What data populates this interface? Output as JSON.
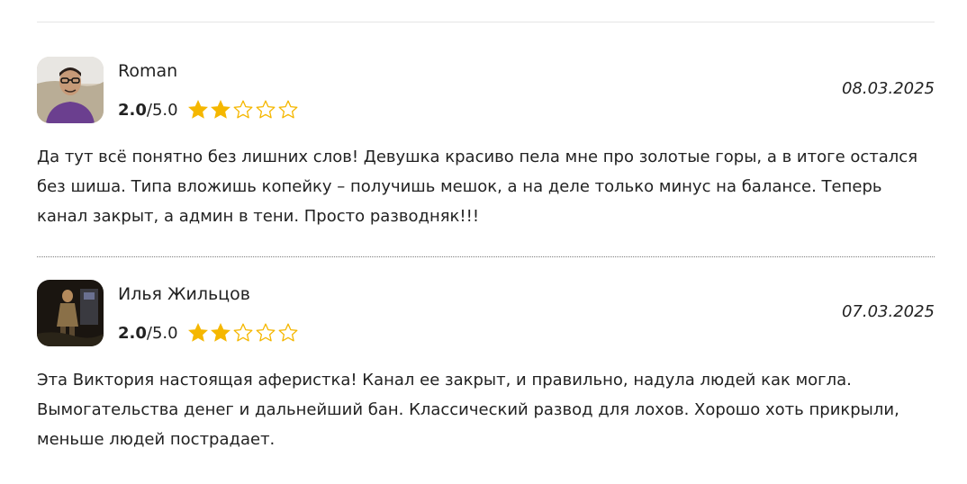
{
  "reviews": [
    {
      "author": "Roman",
      "avatar_icon": "user-photo",
      "rating_value": "2.0",
      "rating_max": "/5.0",
      "stars_filled": 2,
      "stars_total": 5,
      "date": "08.03.2025",
      "text": "Да тут всё понятно без лишних слов! Девушка красиво пела мне про золотые горы, а в итоге остался без шиша. Типа вложишь копейку – получишь мешок, а на деле только минус на балансе. Теперь канал закрыт, а админ в тени. Просто разводняк!!!"
    },
    {
      "author": "Илья Жильцов",
      "avatar_icon": "user-photo",
      "rating_value": "2.0",
      "rating_max": "/5.0",
      "stars_filled": 2,
      "stars_total": 5,
      "date": "07.03.2025",
      "text": "Эта Виктория настоящая аферистка! Канал ее закрыт, и правильно, надула людей как могла. Вымогательства денег и дальнейший бан. Классический развод для лохов. Хорошо хоть прикрыли, меньше людей пострадает."
    }
  ],
  "colors": {
    "star": "#f5b700",
    "text": "#222222",
    "divider": "#7a7a7a"
  }
}
